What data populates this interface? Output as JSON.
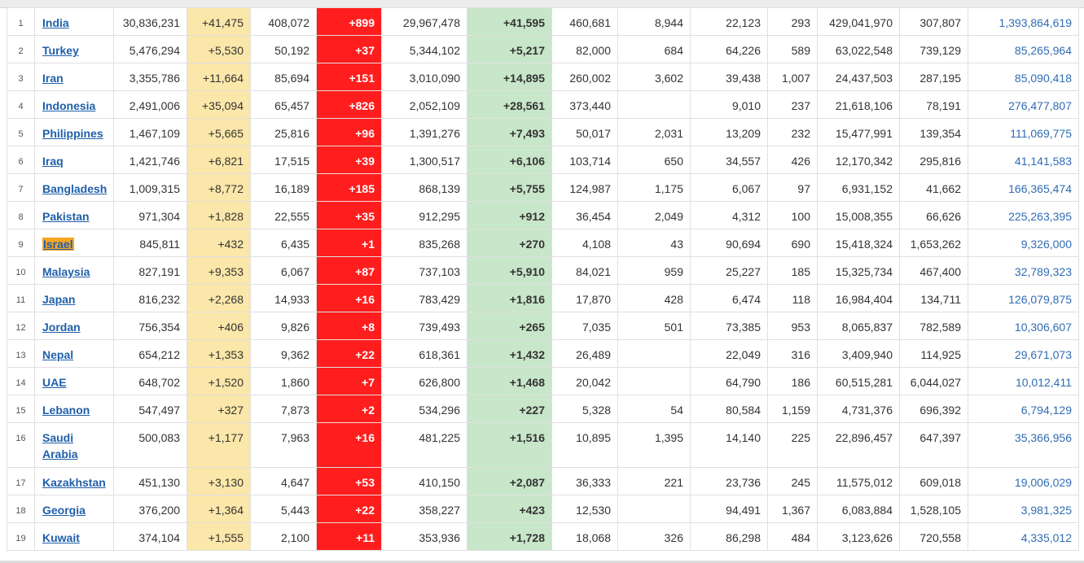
{
  "rows": [
    {
      "rank": "1",
      "country": "India",
      "total_cases": "30,836,231",
      "new_cases": "+41,475",
      "total_deaths": "408,072",
      "new_deaths": "+899",
      "total_recovered": "29,967,478",
      "new_recovered": "+41,595",
      "active": "460,681",
      "serious": "8,944",
      "cases_per_m": "22,123",
      "deaths_per_m": "293",
      "total_tests": "429,041,970",
      "tests_per_m": "307,807",
      "population": "1,393,864,619"
    },
    {
      "rank": "2",
      "country": "Turkey",
      "total_cases": "5,476,294",
      "new_cases": "+5,530",
      "total_deaths": "50,192",
      "new_deaths": "+37",
      "total_recovered": "5,344,102",
      "new_recovered": "+5,217",
      "active": "82,000",
      "serious": "684",
      "cases_per_m": "64,226",
      "deaths_per_m": "589",
      "total_tests": "63,022,548",
      "tests_per_m": "739,129",
      "population": "85,265,964"
    },
    {
      "rank": "3",
      "country": "Iran",
      "total_cases": "3,355,786",
      "new_cases": "+11,664",
      "total_deaths": "85,694",
      "new_deaths": "+151",
      "total_recovered": "3,010,090",
      "new_recovered": "+14,895",
      "active": "260,002",
      "serious": "3,602",
      "cases_per_m": "39,438",
      "deaths_per_m": "1,007",
      "total_tests": "24,437,503",
      "tests_per_m": "287,195",
      "population": "85,090,418"
    },
    {
      "rank": "4",
      "country": "Indonesia",
      "total_cases": "2,491,006",
      "new_cases": "+35,094",
      "total_deaths": "65,457",
      "new_deaths": "+826",
      "total_recovered": "2,052,109",
      "new_recovered": "+28,561",
      "active": "373,440",
      "serious": "",
      "cases_per_m": "9,010",
      "deaths_per_m": "237",
      "total_tests": "21,618,106",
      "tests_per_m": "78,191",
      "population": "276,477,807"
    },
    {
      "rank": "5",
      "country": "Philippines",
      "total_cases": "1,467,109",
      "new_cases": "+5,665",
      "total_deaths": "25,816",
      "new_deaths": "+96",
      "total_recovered": "1,391,276",
      "new_recovered": "+7,493",
      "active": "50,017",
      "serious": "2,031",
      "cases_per_m": "13,209",
      "deaths_per_m": "232",
      "total_tests": "15,477,991",
      "tests_per_m": "139,354",
      "population": "111,069,775"
    },
    {
      "rank": "6",
      "country": "Iraq",
      "total_cases": "1,421,746",
      "new_cases": "+6,821",
      "total_deaths": "17,515",
      "new_deaths": "+39",
      "total_recovered": "1,300,517",
      "new_recovered": "+6,106",
      "active": "103,714",
      "serious": "650",
      "cases_per_m": "34,557",
      "deaths_per_m": "426",
      "total_tests": "12,170,342",
      "tests_per_m": "295,816",
      "population": "41,141,583"
    },
    {
      "rank": "7",
      "country": "Bangladesh",
      "total_cases": "1,009,315",
      "new_cases": "+8,772",
      "total_deaths": "16,189",
      "new_deaths": "+185",
      "total_recovered": "868,139",
      "new_recovered": "+5,755",
      "active": "124,987",
      "serious": "1,175",
      "cases_per_m": "6,067",
      "deaths_per_m": "97",
      "total_tests": "6,931,152",
      "tests_per_m": "41,662",
      "population": "166,365,474"
    },
    {
      "rank": "8",
      "country": "Pakistan",
      "total_cases": "971,304",
      "new_cases": "+1,828",
      "total_deaths": "22,555",
      "new_deaths": "+35",
      "total_recovered": "912,295",
      "new_recovered": "+912",
      "active": "36,454",
      "serious": "2,049",
      "cases_per_m": "4,312",
      "deaths_per_m": "100",
      "total_tests": "15,008,355",
      "tests_per_m": "66,626",
      "population": "225,263,395"
    },
    {
      "rank": "9",
      "country": "Israel",
      "total_cases": "845,811",
      "new_cases": "+432",
      "total_deaths": "6,435",
      "new_deaths": "+1",
      "total_recovered": "835,268",
      "new_recovered": "+270",
      "active": "4,108",
      "serious": "43",
      "cases_per_m": "90,694",
      "deaths_per_m": "690",
      "total_tests": "15,418,324",
      "tests_per_m": "1,653,262",
      "population": "9,326,000"
    },
    {
      "rank": "10",
      "country": "Malaysia",
      "total_cases": "827,191",
      "new_cases": "+9,353",
      "total_deaths": "6,067",
      "new_deaths": "+87",
      "total_recovered": "737,103",
      "new_recovered": "+5,910",
      "active": "84,021",
      "serious": "959",
      "cases_per_m": "25,227",
      "deaths_per_m": "185",
      "total_tests": "15,325,734",
      "tests_per_m": "467,400",
      "population": "32,789,323"
    },
    {
      "rank": "11",
      "country": "Japan",
      "total_cases": "816,232",
      "new_cases": "+2,268",
      "total_deaths": "14,933",
      "new_deaths": "+16",
      "total_recovered": "783,429",
      "new_recovered": "+1,816",
      "active": "17,870",
      "serious": "428",
      "cases_per_m": "6,474",
      "deaths_per_m": "118",
      "total_tests": "16,984,404",
      "tests_per_m": "134,711",
      "population": "126,079,875"
    },
    {
      "rank": "12",
      "country": "Jordan",
      "total_cases": "756,354",
      "new_cases": "+406",
      "total_deaths": "9,826",
      "new_deaths": "+8",
      "total_recovered": "739,493",
      "new_recovered": "+265",
      "active": "7,035",
      "serious": "501",
      "cases_per_m": "73,385",
      "deaths_per_m": "953",
      "total_tests": "8,065,837",
      "tests_per_m": "782,589",
      "population": "10,306,607"
    },
    {
      "rank": "13",
      "country": "Nepal",
      "total_cases": "654,212",
      "new_cases": "+1,353",
      "total_deaths": "9,362",
      "new_deaths": "+22",
      "total_recovered": "618,361",
      "new_recovered": "+1,432",
      "active": "26,489",
      "serious": "",
      "cases_per_m": "22,049",
      "deaths_per_m": "316",
      "total_tests": "3,409,940",
      "tests_per_m": "114,925",
      "population": "29,671,073"
    },
    {
      "rank": "14",
      "country": "UAE",
      "total_cases": "648,702",
      "new_cases": "+1,520",
      "total_deaths": "1,860",
      "new_deaths": "+7",
      "total_recovered": "626,800",
      "new_recovered": "+1,468",
      "active": "20,042",
      "serious": "",
      "cases_per_m": "64,790",
      "deaths_per_m": "186",
      "total_tests": "60,515,281",
      "tests_per_m": "6,044,027",
      "population": "10,012,411"
    },
    {
      "rank": "15",
      "country": "Lebanon",
      "total_cases": "547,497",
      "new_cases": "+327",
      "total_deaths": "7,873",
      "new_deaths": "+2",
      "total_recovered": "534,296",
      "new_recovered": "+227",
      "active": "5,328",
      "serious": "54",
      "cases_per_m": "80,584",
      "deaths_per_m": "1,159",
      "total_tests": "4,731,376",
      "tests_per_m": "696,392",
      "population": "6,794,129"
    },
    {
      "rank": "16",
      "country": "Saudi Arabia",
      "total_cases": "500,083",
      "new_cases": "+1,177",
      "total_deaths": "7,963",
      "new_deaths": "+16",
      "total_recovered": "481,225",
      "new_recovered": "+1,516",
      "active": "10,895",
      "serious": "1,395",
      "cases_per_m": "14,140",
      "deaths_per_m": "225",
      "total_tests": "22,896,457",
      "tests_per_m": "647,397",
      "population": "35,366,956"
    },
    {
      "rank": "17",
      "country": "Kazakhstan",
      "total_cases": "451,130",
      "new_cases": "+3,130",
      "total_deaths": "4,647",
      "new_deaths": "+53",
      "total_recovered": "410,150",
      "new_recovered": "+2,087",
      "active": "36,333",
      "serious": "221",
      "cases_per_m": "23,736",
      "deaths_per_m": "245",
      "total_tests": "11,575,012",
      "tests_per_m": "609,018",
      "population": "19,006,029"
    },
    {
      "rank": "18",
      "country": "Georgia",
      "total_cases": "376,200",
      "new_cases": "+1,364",
      "total_deaths": "5,443",
      "new_deaths": "+22",
      "total_recovered": "358,227",
      "new_recovered": "+423",
      "active": "12,530",
      "serious": "",
      "cases_per_m": "94,491",
      "deaths_per_m": "1,367",
      "total_tests": "6,083,884",
      "tests_per_m": "1,528,105",
      "population": "3,981,325"
    },
    {
      "rank": "19",
      "country": "Kuwait",
      "total_cases": "374,104",
      "new_cases": "+1,555",
      "total_deaths": "2,100",
      "new_deaths": "+11",
      "total_recovered": "353,936",
      "new_recovered": "+1,728",
      "active": "18,068",
      "serious": "326",
      "cases_per_m": "86,298",
      "deaths_per_m": "484",
      "total_tests": "3,123,626",
      "tests_per_m": "720,558",
      "population": "4,335,012"
    }
  ],
  "highlighted_country": "Israel",
  "colors": {
    "new_cases_bg": "#fbe7a9",
    "new_deaths_bg": "#ff1d1d",
    "new_recovered_bg": "#c8e6c9",
    "link": "#1f5faa",
    "population": "#2f6cb3",
    "highlight": "#f5a623"
  }
}
